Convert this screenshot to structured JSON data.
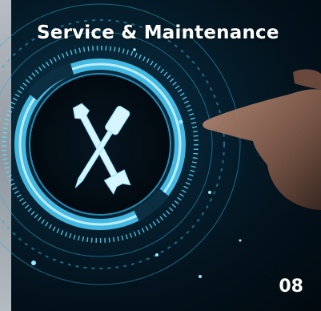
{
  "card": {
    "title": "Service & Maintenance",
    "number": "08"
  },
  "icons": {
    "center": "wrench-and-screwdriver-icon",
    "hand": "pointing-hand"
  },
  "colors": {
    "background": "#03121c",
    "glow": "#36c8ff",
    "text": "#ffffff"
  }
}
